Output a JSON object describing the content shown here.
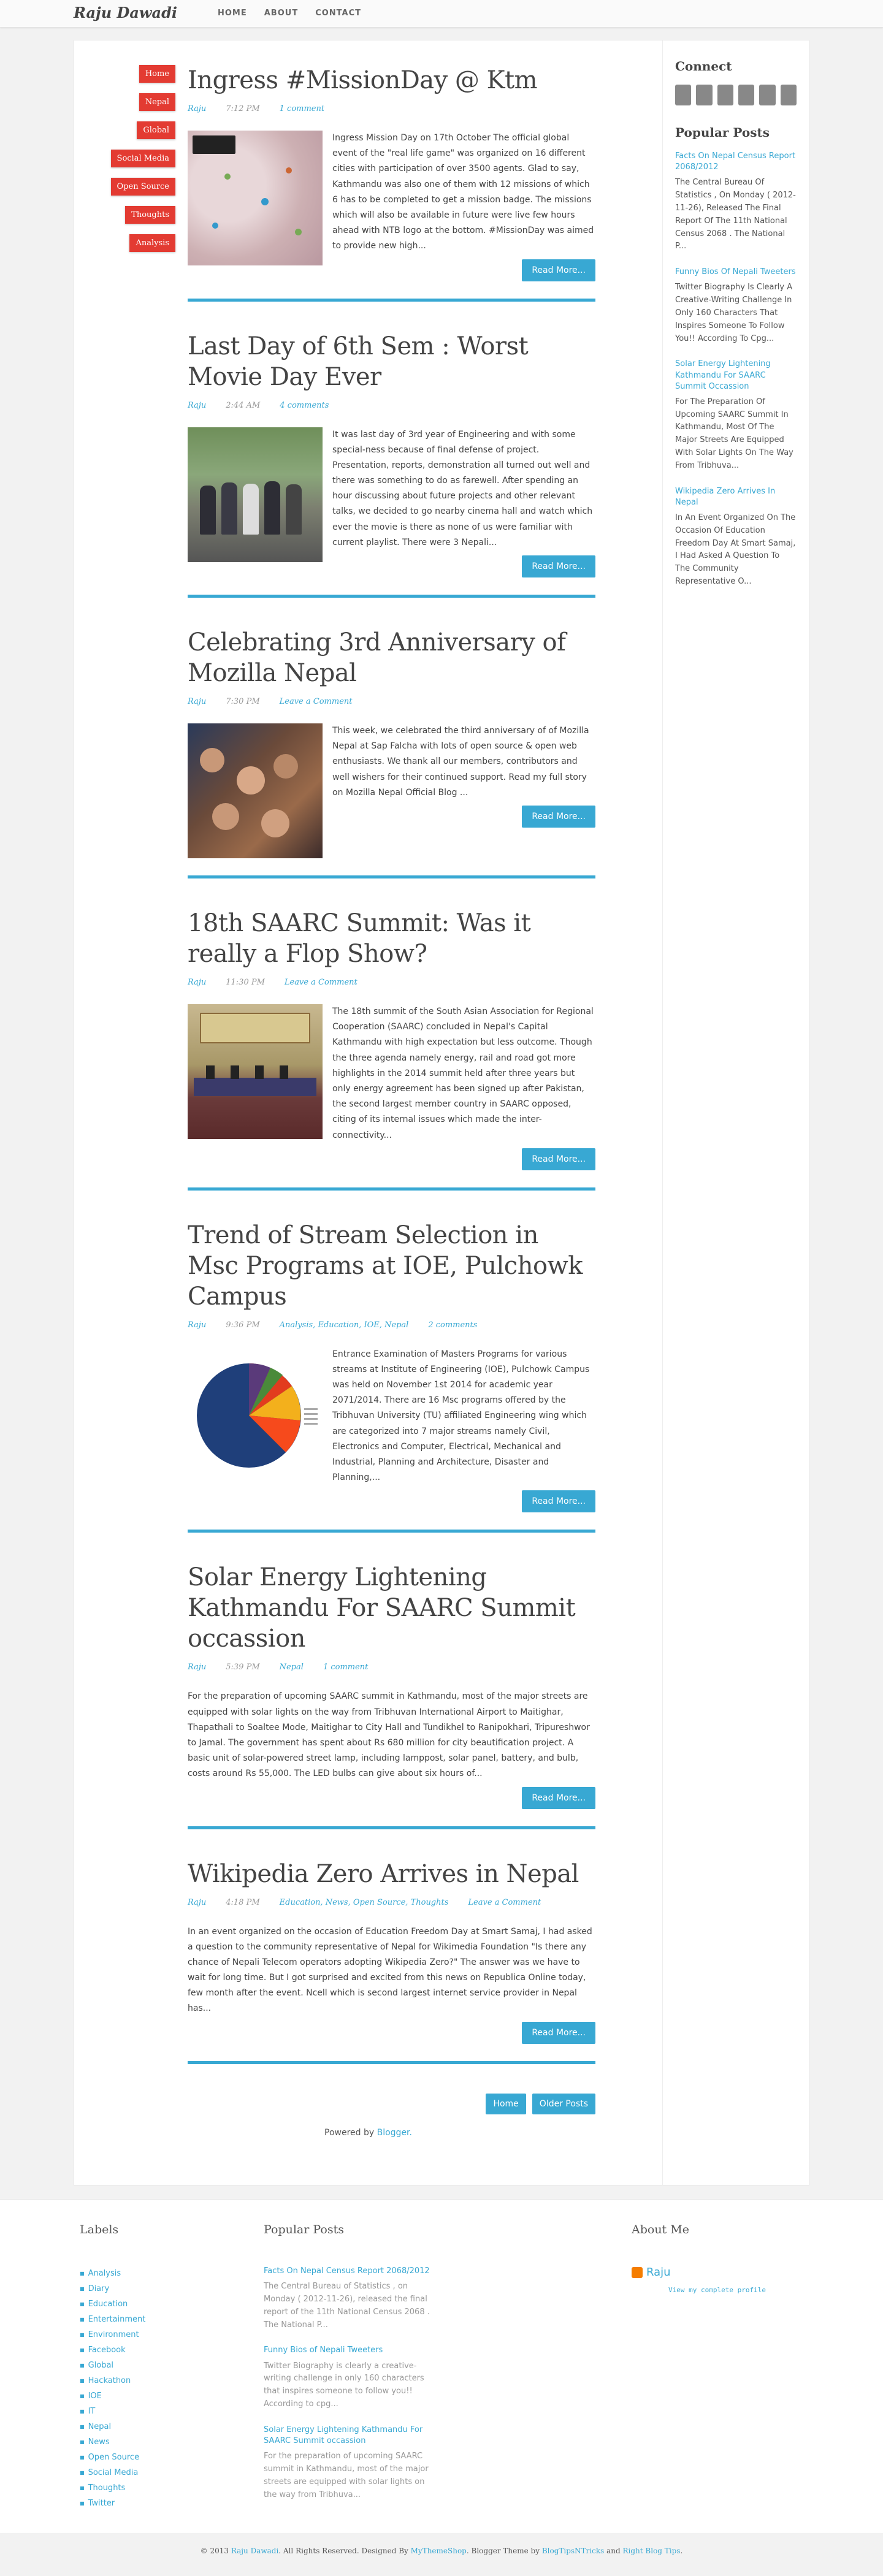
{
  "site": {
    "logo": "Raju Dawadi",
    "nav": [
      "HOME",
      "ABOUT",
      "CONTACT"
    ]
  },
  "categories": [
    "Home",
    "Nepal",
    "Global",
    "Social Media",
    "Open Source",
    "Thoughts",
    "Analysis"
  ],
  "posts": [
    {
      "title": "Ingress #MissionDay @ Ktm",
      "author": "Raju",
      "time": "7:12 PM",
      "tags": "",
      "comments": "1 comment",
      "excerpt": "Ingress Mission Day on 17th October The official global event of the \"real life game\" was organized on 16 different cities with participation of over 3500 agents. Glad to say, Kathmandu was also one of them with 12 missions of which 6 has to be completed to get a mission badge. The missions which will also be available in future were live few hours ahead with NTB logo at the bottom. #MissionDay was aimed to provide new high...",
      "readmore": "Read More..."
    },
    {
      "title": "Last Day of 6th Sem : Worst Movie Day Ever",
      "author": "Raju",
      "time": "2:44 AM",
      "tags": "",
      "comments": "4 comments",
      "excerpt": "It was last day of 3rd year of Engineering and with some special-ness because of final defense of project. Presentation, reports, demonstration all turned out well and there was something to do as farewell. After spending an hour discussing about future projects and other relevant talks, we decided to go nearby cinema hall and watch which ever the movie is there as none of us were familiar with current playlist. There were 3 Nepali...",
      "readmore": "Read More..."
    },
    {
      "title": "Celebrating 3rd Anniversary of Mozilla Nepal",
      "author": "Raju",
      "time": "7:30 PM",
      "tags": "",
      "comments": "Leave a Comment",
      "excerpt": "This week, we celebrated the third anniversary of of Mozilla Nepal at Sap Falcha with lots of open source & open web enthusiasts. We thank all our members, contributors and well wishers for their continued support. Read my full story on Mozilla Nepal Official Blog ...",
      "readmore": "Read More..."
    },
    {
      "title": "18th SAARC Summit: Was it really a Flop Show?",
      "author": "Raju",
      "time": "11:30 PM",
      "tags": "",
      "comments": "Leave a Comment",
      "excerpt": "The 18th summit of the South Asian Association for Regional Cooperation (SAARC) concluded in Nepal's Capital Kathmandu with high expectation but less outcome. Though the three agenda namely energy, rail and road got more highlights in the 2014 summit held after three years but only energy agreement has been signed up after Pakistan, the second largest member country in SAARC opposed, citing of its internal issues which made the inter-connectivity...",
      "readmore": "Read More..."
    },
    {
      "title": "Trend of Stream Selection in Msc Programs at IOE, Pulchowk Campus",
      "author": "Raju",
      "time": "9:36 PM",
      "tags": "Analysis, Education, IOE, Nepal",
      "comments": "2 comments",
      "excerpt": "Entrance Examination of Masters Programs for various streams at Institute of Engineering (IOE), Pulchowk Campus was held on November 1st 2014 for academic year 2071/2014. There are 16 Msc programs offered by the Tribhuvan University (TU) affiliated Engineering wing which are categorized into 7 major streams namely Civil, Electronics and Computer, Electrical, Mechanical and Industrial, Planning and Architecture, Disaster and Planning,...",
      "readmore": "Read More..."
    },
    {
      "title": "Solar Energy Lightening Kathmandu For SAARC Summit occassion",
      "author": "Raju",
      "time": "5:39 PM",
      "tags": "Nepal",
      "comments": "1 comment",
      "excerpt": "For the preparation of upcoming SAARC summit in Kathmandu, most of the major streets are equipped with solar lights on the way from Tribhuvan International Airport to Maitighar, Thapathali to Soaltee Mode, Maitighar to City Hall and Tundikhel to Ranipokhari, Tripureshwor to Jamal. The government has spent about Rs 680 million for city beautification project. A basic unit of solar-powered street lamp, including lamppost, solar panel, battery, and bulb, costs around Rs 55,000. The LED bulbs can give about six hours of...",
      "readmore": "Read More..."
    },
    {
      "title": "Wikipedia Zero Arrives in Nepal",
      "author": "Raju",
      "time": "4:18 PM",
      "tags": "Education, News, Open Source, Thoughts",
      "comments": "Leave a Comment",
      "excerpt": "In an event organized on the occasion of Education Freedom Day at Smart Samaj, I had asked a question to the community representative of Nepal for Wikimedia Foundation \"Is there any chance of Nepali Telecom operators adopting Wikipedia Zero?\" The answer was we have to wait for long time. But I got surprised and excited from this news on Republica Online today, few month after the event. Ncell which is second largest internet service provider in Nepal has...",
      "readmore": "Read More..."
    }
  ],
  "pager": {
    "home": "Home",
    "older": "Older Posts"
  },
  "powered": {
    "prefix": "Powered by ",
    "link": "Blogger."
  },
  "sidebar": {
    "connect_title": "Connect",
    "popular_title": "Popular Posts",
    "popular": [
      {
        "title": "Facts On Nepal Census Report 2068/2012",
        "text": "The Central Bureau Of Statistics , On Monday ( 2012-11-26), Released The Final Report Of The 11th National Census 2068 . The National P..."
      },
      {
        "title": "Funny Bios Of Nepali Tweeters",
        "text": "Twitter Biography Is Clearly A Creative-Writing Challenge In Only 160 Characters That Inspires Someone To Follow You!! According To Cpg..."
      },
      {
        "title": "Solar Energy Lightening Kathmandu For SAARC Summit Occassion",
        "text": "For The Preparation Of Upcoming SAARC Summit In Kathmandu, Most Of The Major Streets Are Equipped With Solar Lights On The Way From Tribhuva..."
      },
      {
        "title": "Wikipedia Zero Arrives In Nepal",
        "text": "In An Event Organized On The Occasion Of Education Freedom Day At Smart Samaj, I Had Asked A Question To The Community Representative O..."
      }
    ]
  },
  "footer": {
    "labels_title": "Labels",
    "labels": [
      "Analysis",
      "Diary",
      "Education",
      "Entertainment",
      "Environment",
      "Facebook",
      "Global",
      "Hackathon",
      "IOE",
      "IT",
      "Nepal",
      "News",
      "Open Source",
      "Social Media",
      "Thoughts",
      "Twitter"
    ],
    "popular_title": "Popular Posts",
    "popular": [
      {
        "title": "Facts On Nepal Census Report 2068/2012",
        "text": "The Central Bureau of Statistics , on Monday ( 2012-11-26), released the final report of the 11th National Census 2068 . The National P..."
      },
      {
        "title": "Funny Bios of Nepali Tweeters",
        "text": "Twitter Biography is clearly a creative-writing challenge in only 160 characters that inspires someone to follow you!! According to cpg..."
      },
      {
        "title": "Solar Energy Lightening Kathmandu For SAARC Summit occassion",
        "text": "For the preparation of upcoming SAARC summit in Kathmandu, most of the major streets are equipped with solar lights on the way from Tribhuva..."
      }
    ],
    "about_title": "About Me",
    "about_name": "Raju",
    "about_link": "View my complete profile"
  },
  "copyright": {
    "prefix": "© 2013 ",
    "name": "Raju Dawadi",
    "mid1": ". All Rights Reserved. Designed By ",
    "designer": "MyThemeShop",
    "mid2": ". Blogger Theme by ",
    "theme": "BlogTipsNTricks",
    "mid3": " and ",
    "other": "Right Blog Tips",
    "end": "."
  },
  "colors": {
    "accent": "#38a8d3",
    "category": "#e33b32"
  }
}
